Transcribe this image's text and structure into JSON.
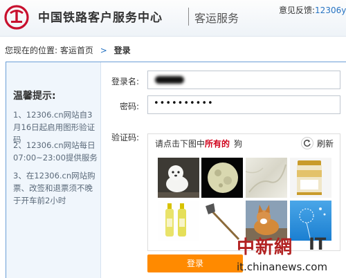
{
  "header": {
    "title": "中国铁路客户服务中心",
    "subtitle": "客运服务",
    "feedback_label": "意见反馈:",
    "feedback_email": "12306y"
  },
  "breadcrumb": {
    "prefix": "您现在的位置:",
    "home": "客运首页",
    "separator": ">",
    "current": "登录"
  },
  "tips": {
    "title": "温馨提示:",
    "items": [
      "1、12306.cn网站自3月16日起启用图形验证码",
      "2、12306.cn网站每日07:00~23:00提供服务",
      "3、在12306.cn网站购票、改签和退票须不晚于开车前2小时"
    ]
  },
  "form": {
    "username_label": "登录名:",
    "password_label": "密码:",
    "password_mask": "••••••••••",
    "captcha_label": "验证码:",
    "login_button": "登录"
  },
  "captcha": {
    "prompt_prefix": "请点击下图中",
    "prompt_highlight": "所有的",
    "prompt_word": "狗",
    "refresh_label": "刷新",
    "images": [
      "white-dog",
      "full-moon",
      "marble-texture",
      "milk-powder-can",
      "bottles",
      "hoe-tool",
      "corgi-dog",
      "dandelion-sky"
    ]
  },
  "watermark": {
    "chinese": "中新網",
    "it": "IT",
    "url": "it.chinanews.com"
  },
  "colors": {
    "accent": "#2673c2",
    "highlight": "#d0021b",
    "button": "#ff8a00",
    "logo": "#c8102e"
  }
}
